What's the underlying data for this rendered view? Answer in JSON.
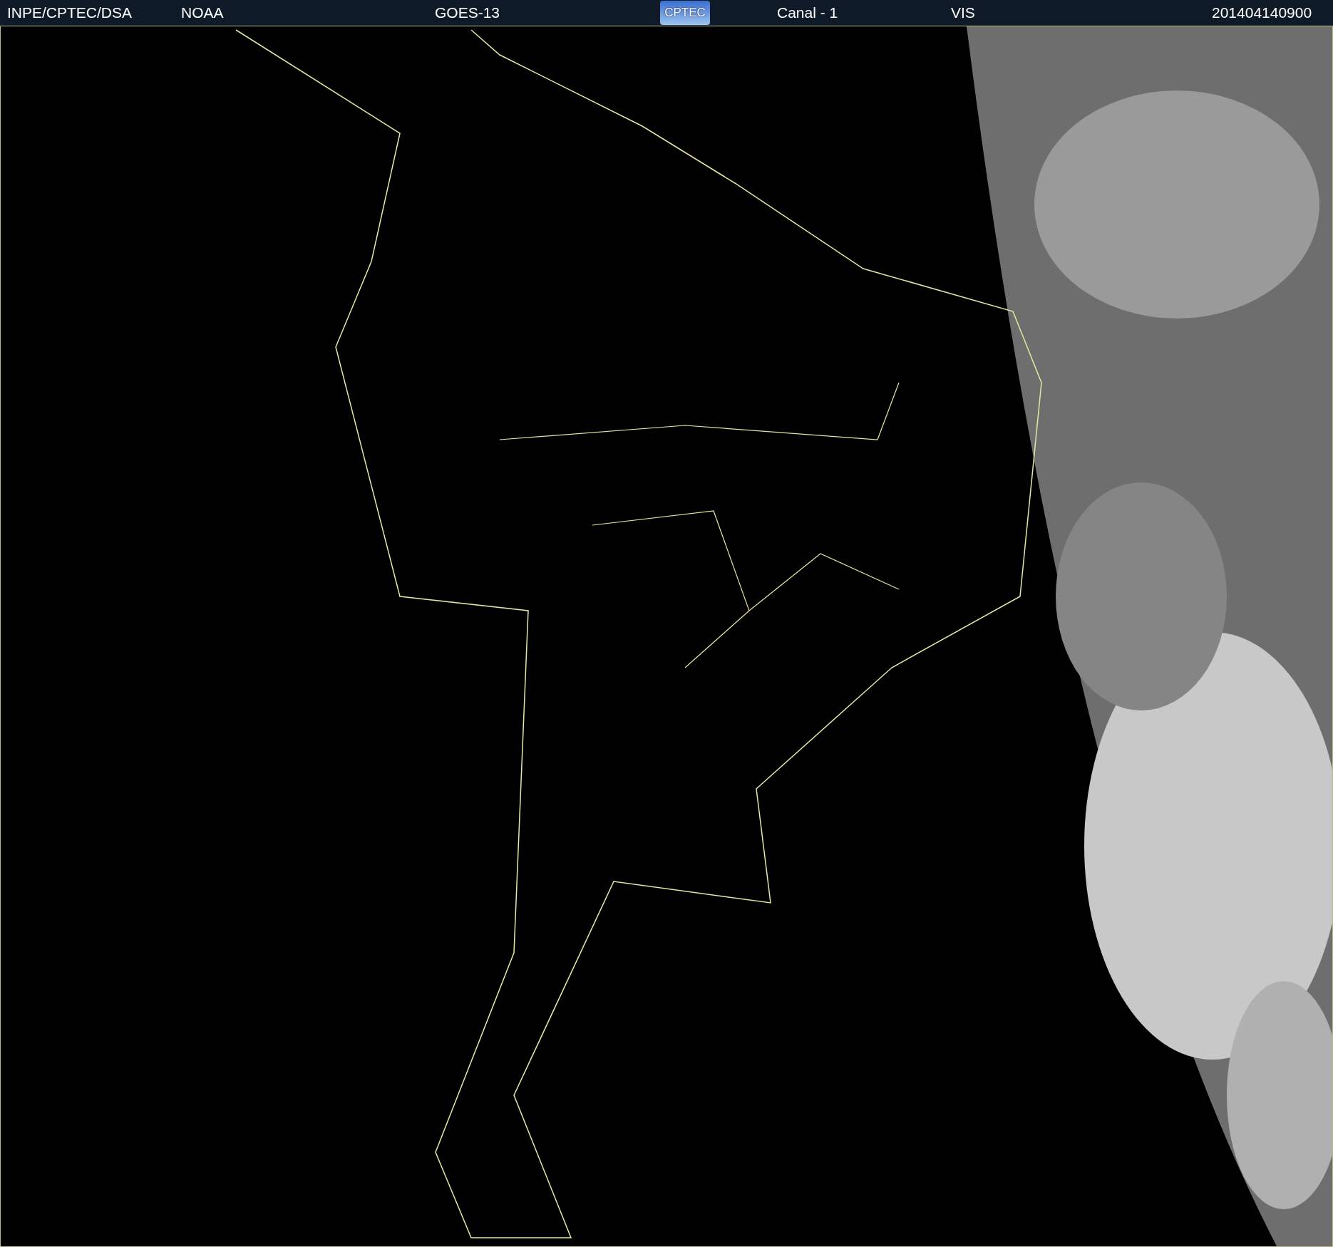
{
  "header": {
    "items": [
      {
        "kind": "text",
        "label": "INPE/CPTEC/DSA"
      },
      {
        "kind": "text",
        "label": "NOAA"
      },
      {
        "kind": "text",
        "label": "GOES-13"
      },
      {
        "kind": "logo",
        "label": "CPTEC"
      },
      {
        "kind": "text",
        "label": "Canal - 1"
      },
      {
        "kind": "text",
        "label": "VIS"
      },
      {
        "kind": "text",
        "label": "201404140900"
      }
    ]
  }
}
